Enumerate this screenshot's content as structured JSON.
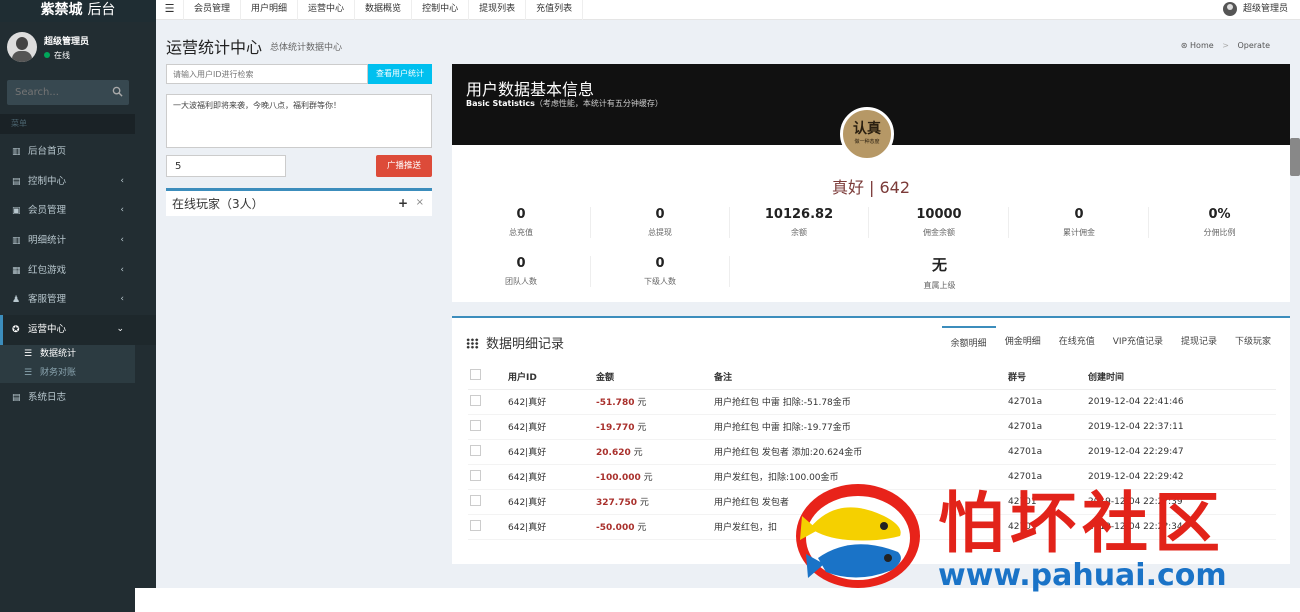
{
  "brand": {
    "name": "紫禁城",
    "suffix": "后台"
  },
  "user": {
    "name": "超级管理员",
    "status": "在线"
  },
  "search": {
    "placeholder": "Search..."
  },
  "sidebar": {
    "header": "菜单",
    "items": [
      {
        "label": "后台首页",
        "icon": "chart-icon",
        "glyph": "▥"
      },
      {
        "label": "控制中心",
        "icon": "panel-icon",
        "glyph": "▤"
      },
      {
        "label": "会员管理",
        "icon": "member-icon",
        "glyph": "▣"
      },
      {
        "label": "明细统计",
        "icon": "stats-icon",
        "glyph": "▥"
      },
      {
        "label": "红包游戏",
        "icon": "redpacket-icon",
        "glyph": "▦"
      },
      {
        "label": "客服管理",
        "icon": "users-icon",
        "glyph": "♟"
      },
      {
        "label": "运营中心",
        "icon": "medal-icon",
        "glyph": "✪"
      }
    ],
    "sub_items": [
      {
        "label": "数据统计",
        "glyph": "☰"
      },
      {
        "label": "财务对账",
        "glyph": "☰"
      }
    ],
    "last_item": {
      "label": "系统日志",
      "glyph": "▤"
    }
  },
  "topnav": [
    "会员管理",
    "用户明细",
    "运营中心",
    "数据概览",
    "控制中心",
    "提现列表",
    "充值列表"
  ],
  "page": {
    "title": "运营统计中心",
    "subtitle": "总体统计数据中心"
  },
  "breadcrumb": {
    "home": "Home",
    "current": "Operate"
  },
  "controls": {
    "uid_placeholder": "请输入用户ID进行检索",
    "uid_button": "查看用户统计",
    "broadcast_text": "一大波福利即将来袭，今晚八点，福利群等你！",
    "number_value": "5",
    "broadcast_button": "广播推送",
    "online_title": "在线玩家（3人）"
  },
  "info": {
    "title": "用户数据基本信息",
    "sub_en": "Basic Statistics",
    "sub_cn": "（考虑性能，本统计有五分钟缓存）",
    "badge_big": "认真",
    "badge_small": "做一种态度",
    "user_line": "真好 | 642",
    "stats_row1": [
      {
        "value": "0",
        "label": "总充值"
      },
      {
        "value": "0",
        "label": "总提现"
      },
      {
        "value": "10126.82",
        "label": "余额"
      },
      {
        "value": "10000",
        "label": "佣金余额"
      },
      {
        "value": "0",
        "label": "累计佣金"
      },
      {
        "value": "0%",
        "label": "分佣比例"
      }
    ],
    "stats_row2": [
      {
        "value": "0",
        "label": "团队人数"
      },
      {
        "value": "0",
        "label": "下级人数"
      },
      {
        "value": "无",
        "label": "直属上级"
      }
    ]
  },
  "records": {
    "title": "数据明细记录",
    "tabs": [
      "余额明细",
      "佣金明细",
      "在线充值",
      "VIP充值记录",
      "提现记录",
      "下级玩家"
    ],
    "columns": [
      "用户ID",
      "金额",
      "备注",
      "群号",
      "创建时间"
    ],
    "rows": [
      {
        "uid": "642|真好",
        "amount": "-51.780",
        "unit": "元",
        "note": "用户抢红包 中雷 扣除:-51.78金币",
        "group": "42701a",
        "time": "2019-12-04 22:41:46"
      },
      {
        "uid": "642|真好",
        "amount": "-19.770",
        "unit": "元",
        "note": "用户抢红包 中雷 扣除:-19.77金币",
        "group": "42701a",
        "time": "2019-12-04 22:37:11"
      },
      {
        "uid": "642|真好",
        "amount": "20.620",
        "unit": "元",
        "note": "用户抢红包 发包者 添加:20.624金币",
        "group": "42701a",
        "time": "2019-12-04 22:29:47"
      },
      {
        "uid": "642|真好",
        "amount": "-100.000",
        "unit": "元",
        "note": "用户发红包，扣除:100.00金币",
        "group": "42701a",
        "time": "2019-12-04 22:29:42"
      },
      {
        "uid": "642|真好",
        "amount": "327.750",
        "unit": "元",
        "note": "用户抢红包 发包者",
        "group": "42701",
        "time": "2019-12-04 22:2?:39"
      },
      {
        "uid": "642|真好",
        "amount": "-50.000",
        "unit": "元",
        "note": "用户发红包，扣",
        "group": "42701",
        "time": "2019-12-04 22:2?:34"
      }
    ]
  },
  "watermark": {
    "text": "怕坏社区",
    "url": "www.pahuai.com"
  },
  "colors": {
    "sidebar": "#222d32",
    "accent": "#3c8dbc",
    "info_btn": "#00c0ef",
    "danger_btn": "#dd4b39",
    "amount": "#a9302c"
  }
}
